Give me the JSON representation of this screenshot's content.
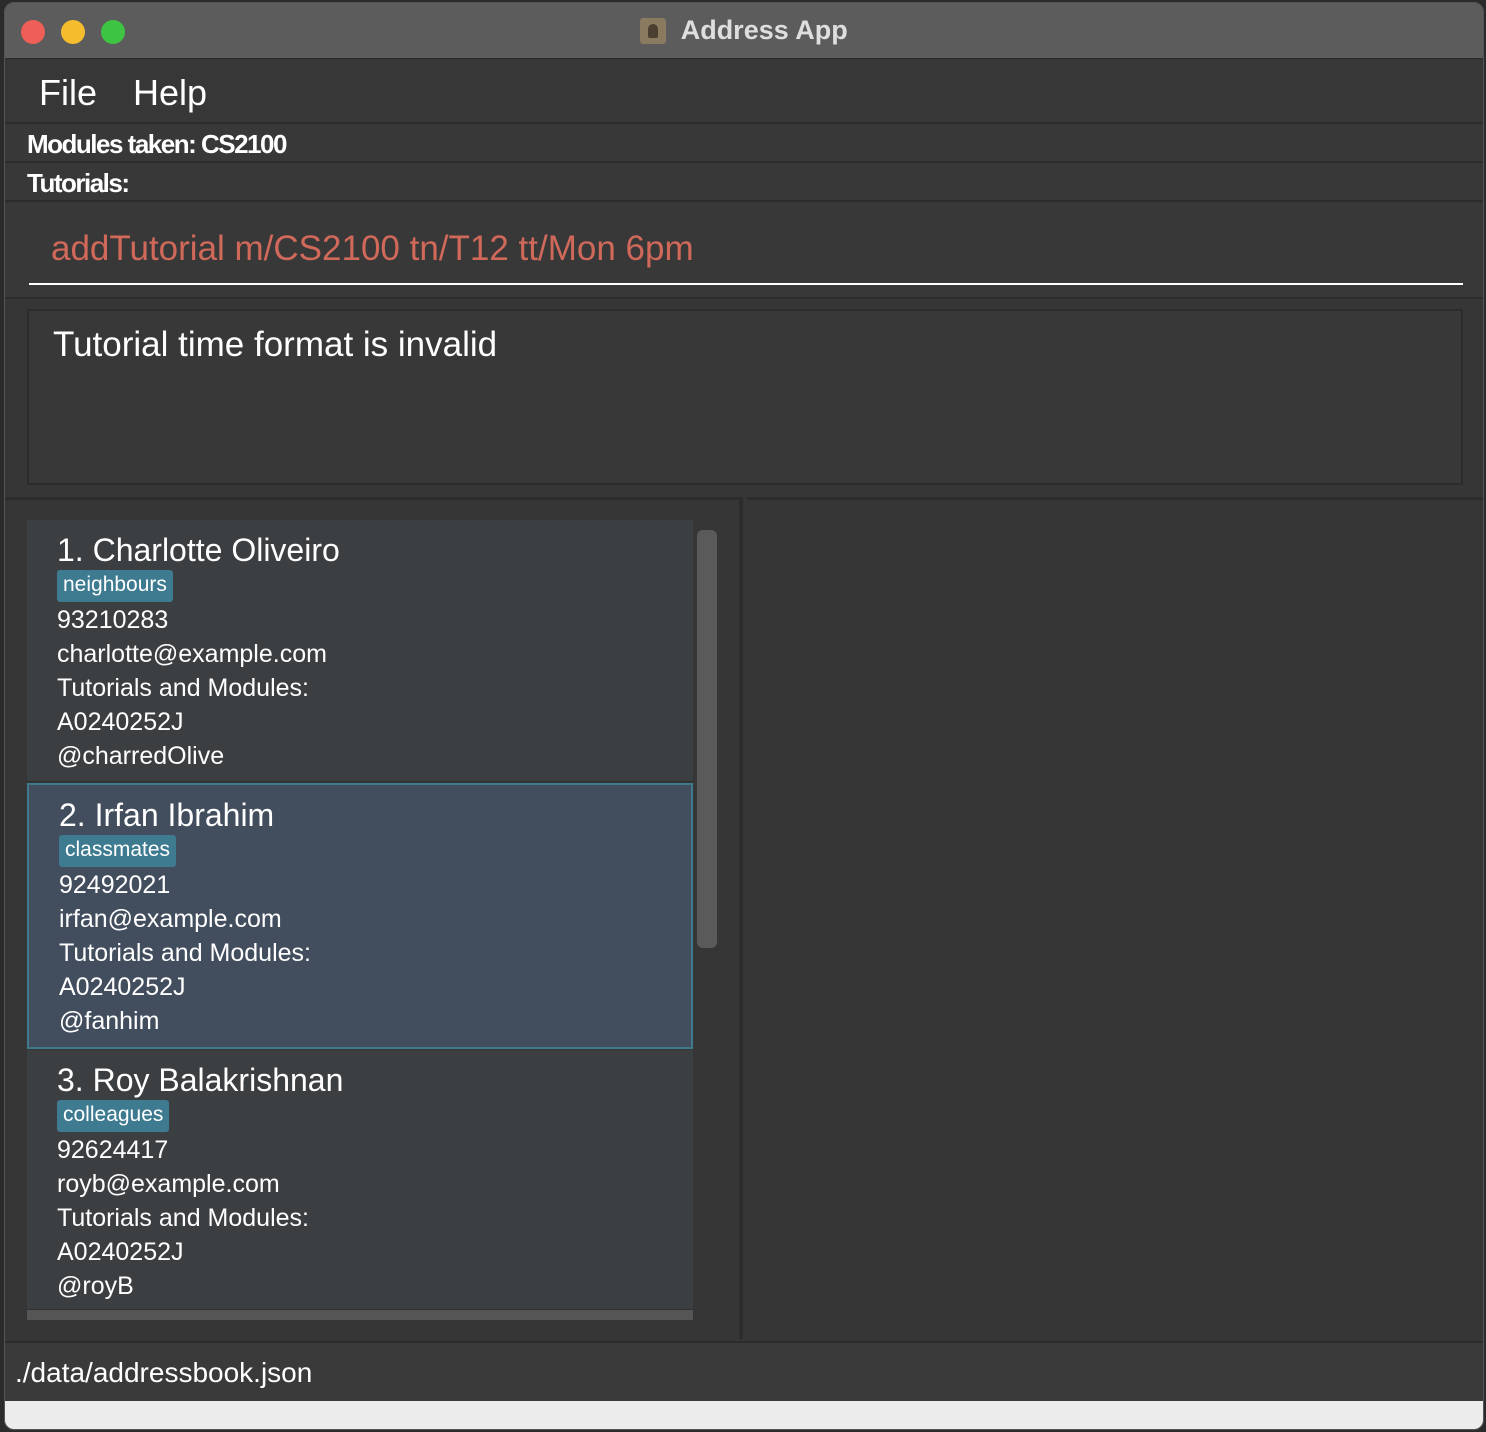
{
  "window": {
    "title": "Address App"
  },
  "menu": {
    "file": "File",
    "help": "Help"
  },
  "info": {
    "modules": "Modules taken: CS2100",
    "tutorials": "Tutorials:"
  },
  "command": {
    "value": "addTutorial m/CS2100 tn/T12 tt/Mon 6pm"
  },
  "result": {
    "message": "Tutorial time format is invalid"
  },
  "persons": [
    {
      "name": "1.  Charlotte Oliveiro",
      "tag": "neighbours",
      "phone": "93210283",
      "email": "charlotte@example.com",
      "tut_label": "Tutorials and Modules:",
      "id": "A0240252J",
      "telegram": "@charredOlive"
    },
    {
      "name": "2.  Irfan Ibrahim",
      "tag": "classmates",
      "phone": "92492021",
      "email": "irfan@example.com",
      "tut_label": "Tutorials and Modules:",
      "id": "A0240252J",
      "telegram": "@fanhim"
    },
    {
      "name": "3.  Roy Balakrishnan",
      "tag": "colleagues",
      "phone": "92624417",
      "email": "royb@example.com",
      "tut_label": "Tutorials and Modules:",
      "id": "A0240252J",
      "telegram": "@royB"
    }
  ],
  "status": {
    "path": "./data/addressbook.json"
  },
  "colors": {
    "command_text": "#d0695a",
    "tag_bg": "#3e7b91",
    "selected_card": "#424e5e"
  }
}
